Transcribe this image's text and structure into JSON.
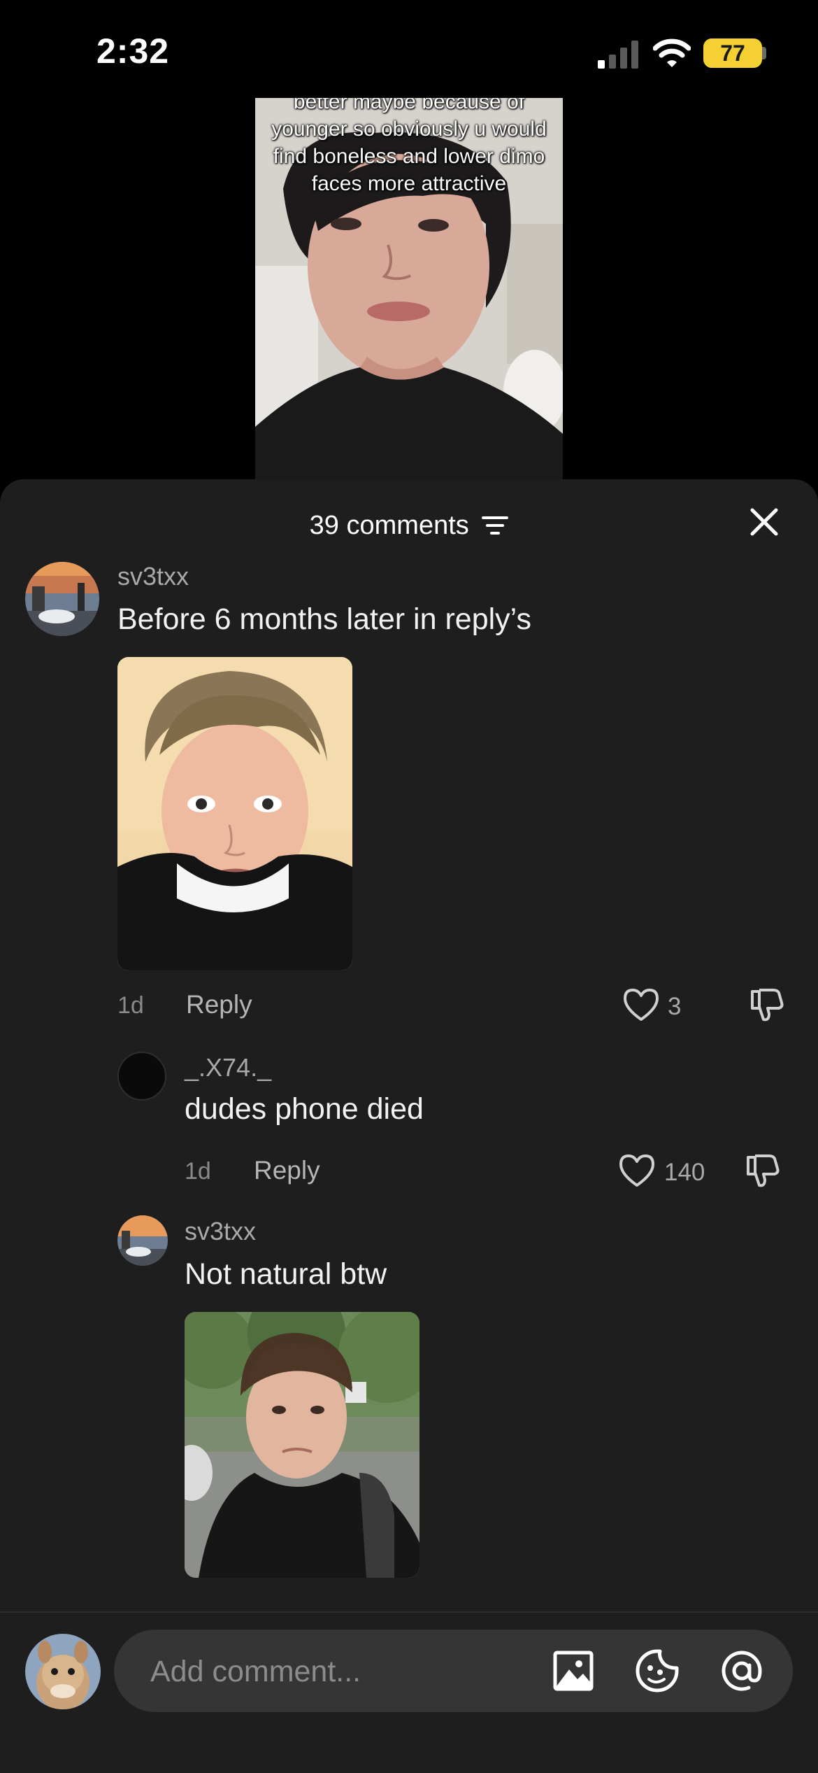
{
  "status_bar": {
    "time": "2:32",
    "battery": "77"
  },
  "video": {
    "caption": "better maybe because of younger so obviously u would find boneless and lower dimo faces more attractive"
  },
  "comments_sheet": {
    "count_label": "39 comments",
    "comments": [
      {
        "username": "sv3txx",
        "text": "Before 6 months later in reply’s",
        "time": "1d",
        "reply_label": "Reply",
        "likes": "3"
      },
      {
        "username": "_.X74._",
        "text": "dudes phone died",
        "time": "1d",
        "reply_label": "Reply",
        "likes": "140"
      },
      {
        "username": "sv3txx",
        "text": "Not natural btw"
      }
    ]
  },
  "input_bar": {
    "placeholder": "Add comment..."
  },
  "colors": {
    "sheet_bg": "#1e1e1e",
    "battery_fill": "#f5d033",
    "input_pill": "#353535"
  }
}
